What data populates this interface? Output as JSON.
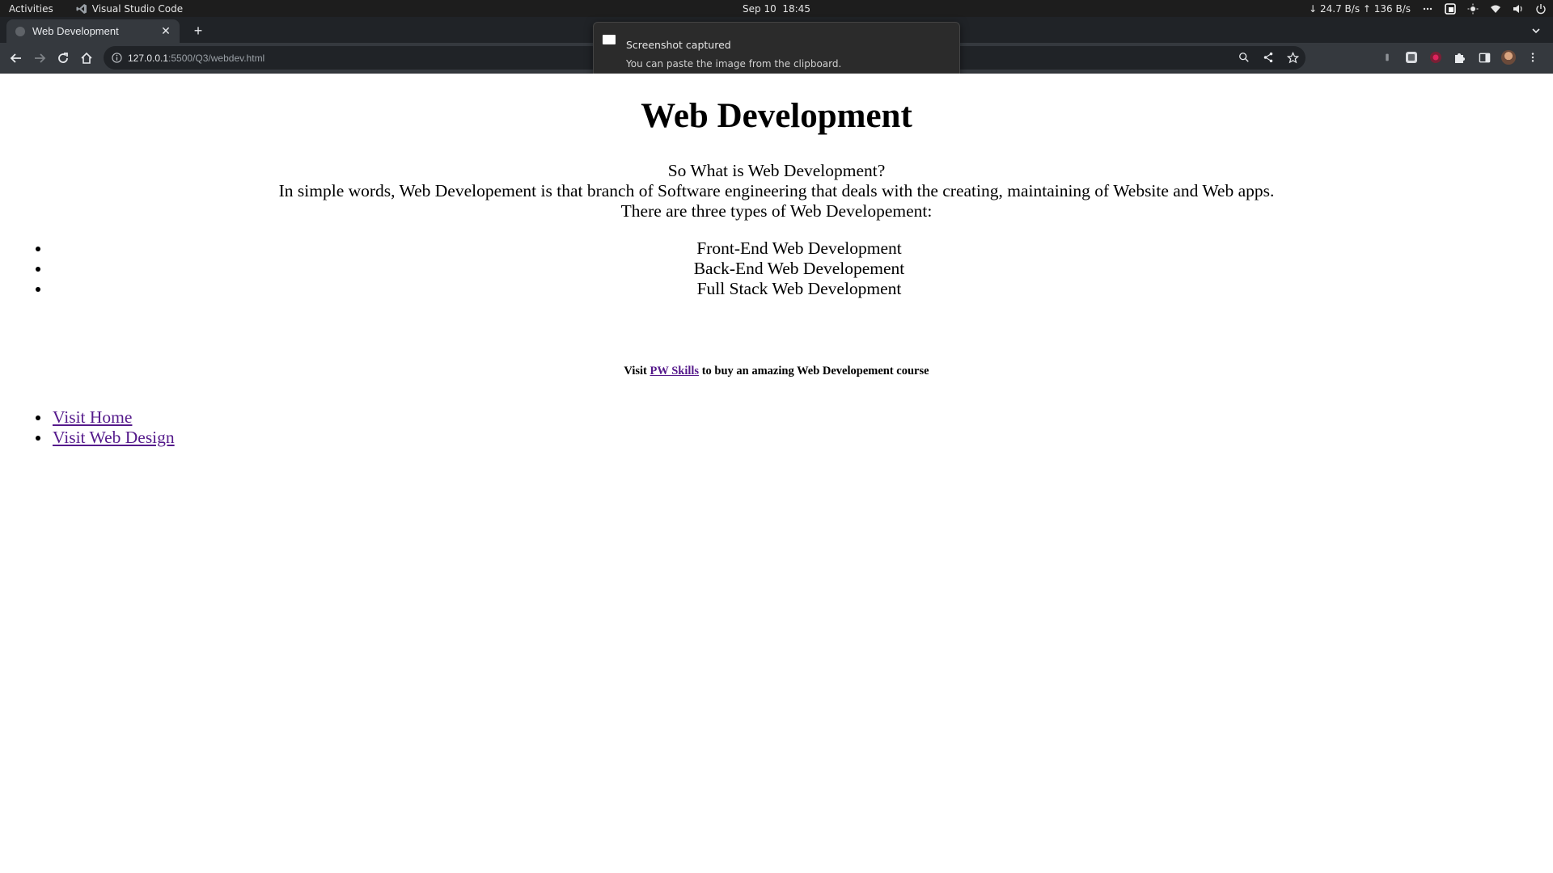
{
  "system_bar": {
    "activities": "Activities",
    "app_name": "Visual Studio Code",
    "clock": "Sep 10  18:45",
    "net_speed": "↓ 24.7 B/s ↑ 136 B/s"
  },
  "browser": {
    "tab_title": "Web Development",
    "url_host": "127.0.0.1",
    "url_path": ":5500/Q3/webdev.html"
  },
  "notification": {
    "title": "Screenshot captured",
    "body": "You can paste the image from the clipboard."
  },
  "page": {
    "heading": "Web Development",
    "intro_lines": [
      "So What is Web Development?",
      "In simple words, Web Developement is that branch of Software engineering that deals with the creating, maintaining of Website and Web apps.",
      "There are three types of Web Developement:"
    ],
    "types": [
      "Front-End Web Development",
      "Back-End Web Developement",
      "Full Stack Web Development"
    ],
    "promo": {
      "prefix": "Visit ",
      "link_text": "PW Skills",
      "suffix": " to buy an amazing Web Developement course"
    },
    "links": [
      "Visit Home",
      "Visit Web Design"
    ]
  }
}
